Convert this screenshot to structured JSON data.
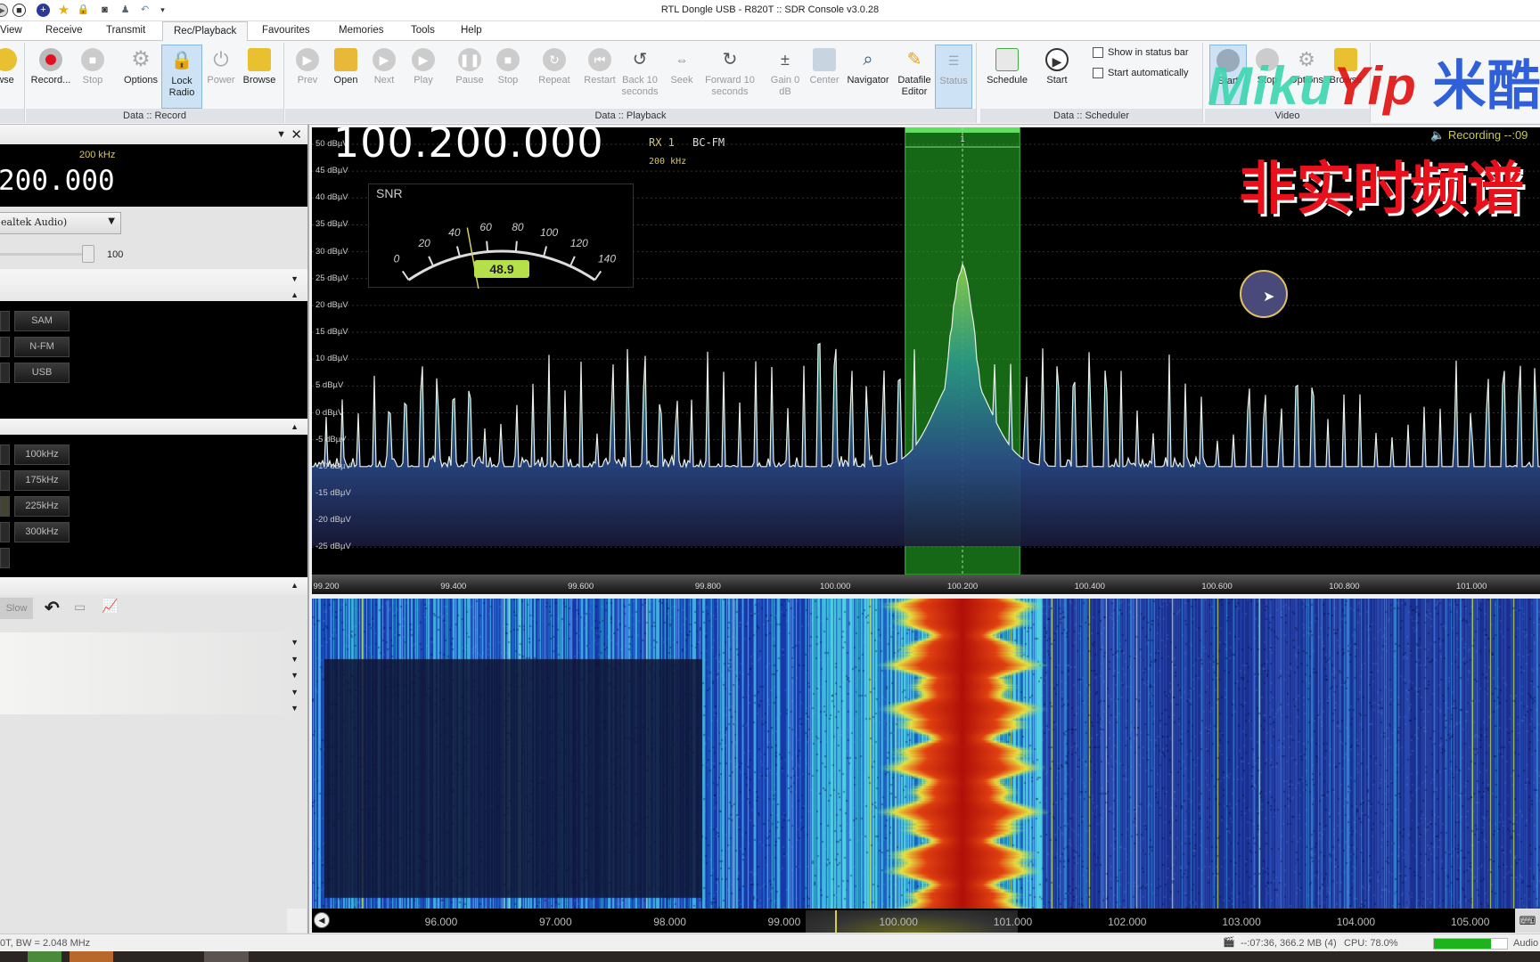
{
  "window": {
    "title": "RTL Dongle USB - R820T :: SDR Console v3.0.28"
  },
  "quick_access": [
    "play-icon",
    "stop-icon",
    "plus-icon",
    "star-icon",
    "lock-icon",
    "camera-icon",
    "user-icon",
    "undo-icon",
    "customize-icon"
  ],
  "menu": [
    "View",
    "Receive",
    "Transmit",
    "Rec/Playback",
    "Favourites",
    "Memories",
    "Tools",
    "Help"
  ],
  "menu_selected": "Rec/Playback",
  "ribbon": {
    "partial_button": "wse",
    "groups": [
      "Data :: Record",
      "Data :: Playback",
      "Data :: Scheduler",
      "Video"
    ],
    "record": [
      "Record...",
      "Stop",
      "Options",
      "Lock Radio",
      "Power",
      "Browse"
    ],
    "playback": [
      "Prev",
      "Open",
      "Next",
      "Play",
      "Pause",
      "Stop",
      "Repeat",
      "Restart",
      "Back 10 seconds",
      "Seek",
      "Forward 10 seconds",
      "Gain 0 dB",
      "Center",
      "Navigator",
      "Datafile Editor",
      "Status"
    ],
    "scheduler": [
      "Schedule",
      "Start"
    ],
    "checkboxes": [
      {
        "label": "Show in status bar",
        "checked": false
      },
      {
        "label": "Start automatically",
        "checked": false
      }
    ],
    "video": [
      "Start",
      "Stop",
      "Options",
      "Browse"
    ]
  },
  "watermark": {
    "part1": "Miku",
    "part2": "Yip",
    "part3": "米酷"
  },
  "left_panel": {
    "bandwidth": "200 kHz",
    "frequency": "200.000",
    "audio_device": "ealtek Audio)",
    "volume": "100",
    "volume_level": 100,
    "modes": [
      "SAM",
      "N-FM",
      "USB"
    ],
    "filters": [
      "100kHz",
      "175kHz",
      "225kHz",
      "300kHz"
    ],
    "slow_button": "Slow"
  },
  "spectrum": {
    "frequency": "100.200.000",
    "rx": "RX 1",
    "mode": "BC-FM",
    "bandwidth": "200 kHz",
    "snr_label": "SNR",
    "snr_value": "48.9",
    "snr_ticks": [
      "0",
      "20",
      "40",
      "60",
      "80",
      "100",
      "120",
      "140"
    ],
    "db_labels": [
      "50 dBµV",
      "45 dBµV",
      "40 dBµV",
      "35 dBµV",
      "30 dBµV",
      "25 dBµV",
      "20 dBµV",
      "15 dBµV",
      "10 dBµV",
      "5 dBµV",
      "0 dBµV",
      "-5 dBµV",
      "-10 dBµV",
      "-15 dBµV",
      "-20 dBµV",
      "-25 dBµV"
    ],
    "freq_labels": [
      "99.200",
      "99.400",
      "99.600",
      "99.800",
      "100.000",
      "100.200",
      "100.400",
      "100.600",
      "100.800",
      "101.000"
    ],
    "vfo_marker": "1",
    "recording": "Recording --:09",
    "overlay_text": "非实时频谱"
  },
  "waterfall": {
    "freq_labels": [
      "96.000",
      "97.000",
      "98.000",
      "99.000",
      "100.000",
      "101.000",
      "102.000",
      "103.000",
      "104.000",
      "105.000"
    ]
  },
  "statusbar": {
    "left": "0T, BW = 2.048 MHz",
    "recording": "--:07:36, 366.2 MB (4)",
    "cpu": "CPU: 78.0%",
    "cpu_level": 78,
    "audio": "Audio"
  },
  "colors": {
    "accent_green": "#3fbf3f",
    "snr_badge": "#b6e04a",
    "overlay_red": "#e8101a",
    "watermark_green": "#3dd6b0",
    "watermark_red": "#e01010",
    "watermark_blue": "#1a4fd6"
  }
}
